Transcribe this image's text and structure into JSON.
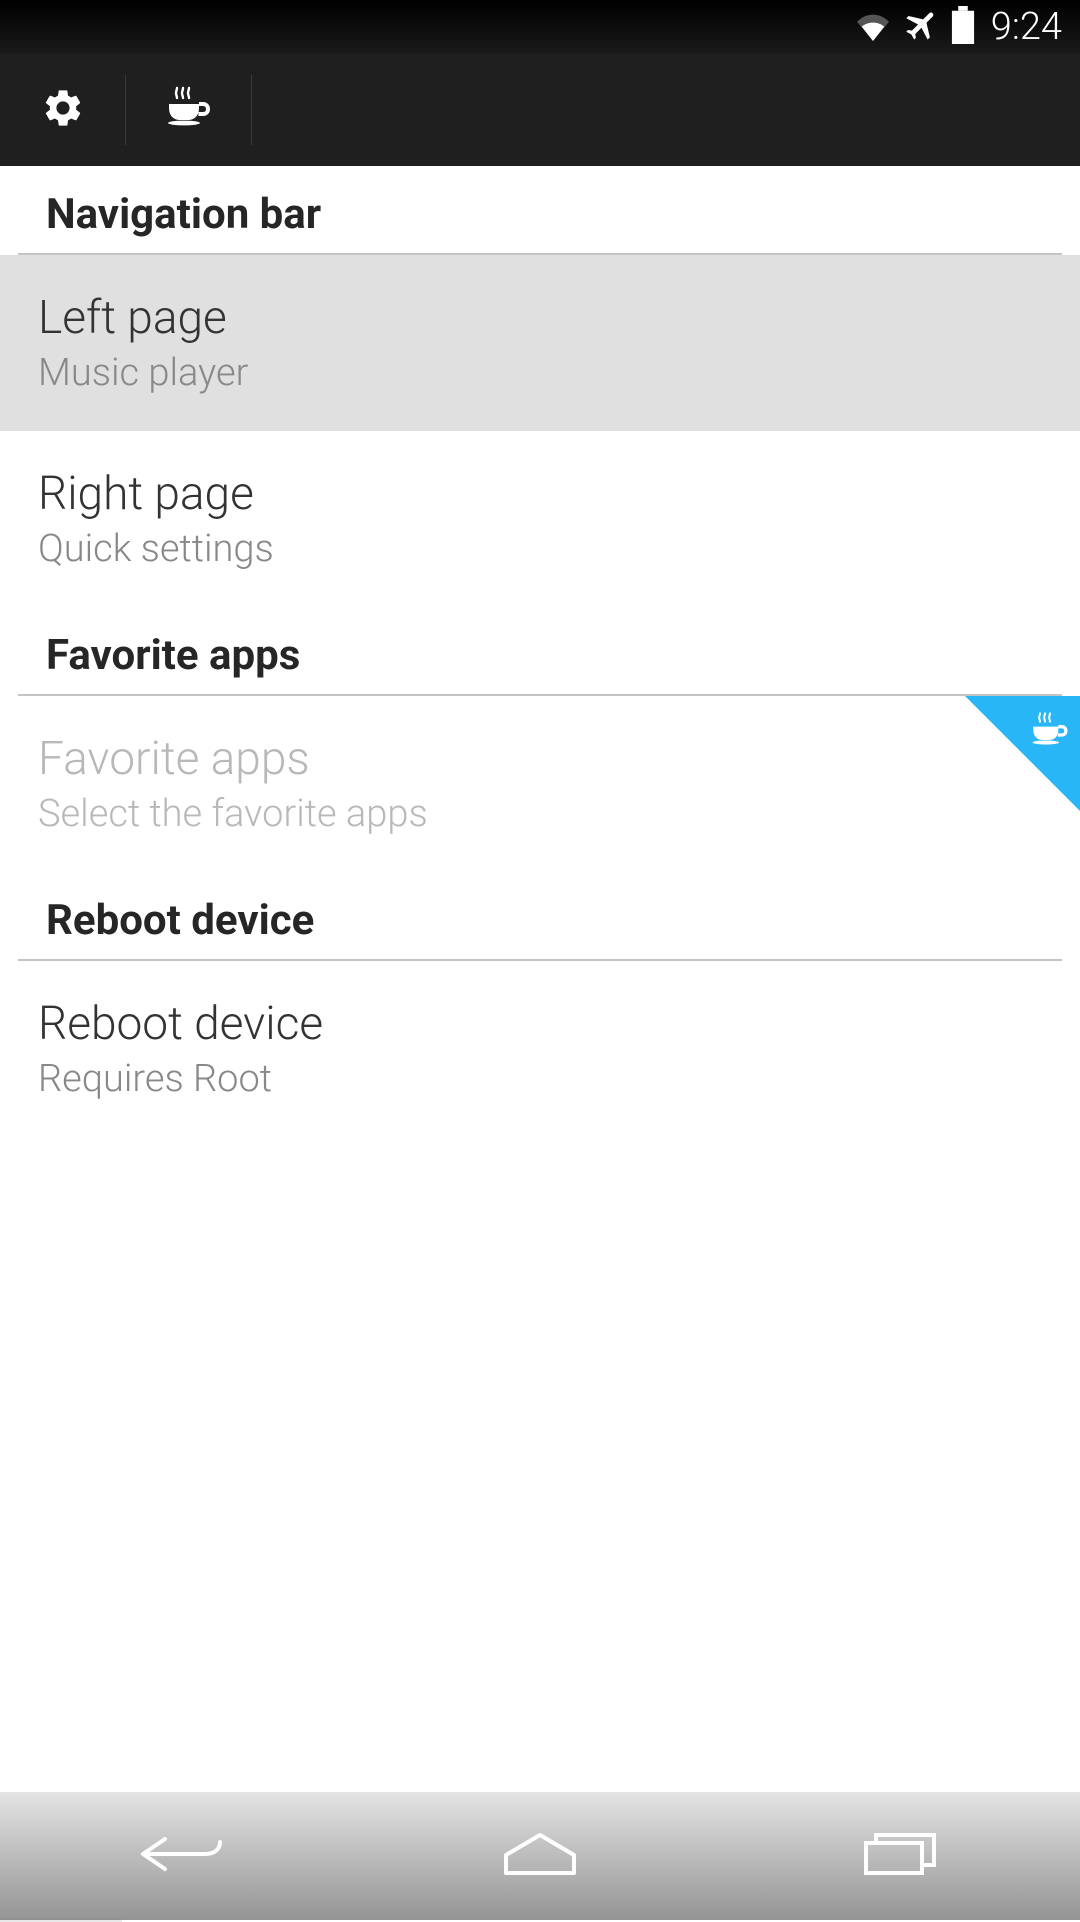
{
  "status_bar": {
    "time": "9:24"
  },
  "sections": [
    {
      "header": "Navigation bar",
      "items": [
        {
          "title": "Left page",
          "subtitle": "Music player",
          "highlighted": true
        },
        {
          "title": "Right page",
          "subtitle": "Quick settings"
        }
      ]
    },
    {
      "header": "Favorite apps",
      "items": [
        {
          "title": "Favorite apps",
          "subtitle": "Select the favorite apps",
          "premium": true,
          "disabled": true
        }
      ]
    },
    {
      "header": "Reboot device",
      "items": [
        {
          "title": "Reboot device",
          "subtitle": "Requires Root"
        }
      ]
    }
  ]
}
